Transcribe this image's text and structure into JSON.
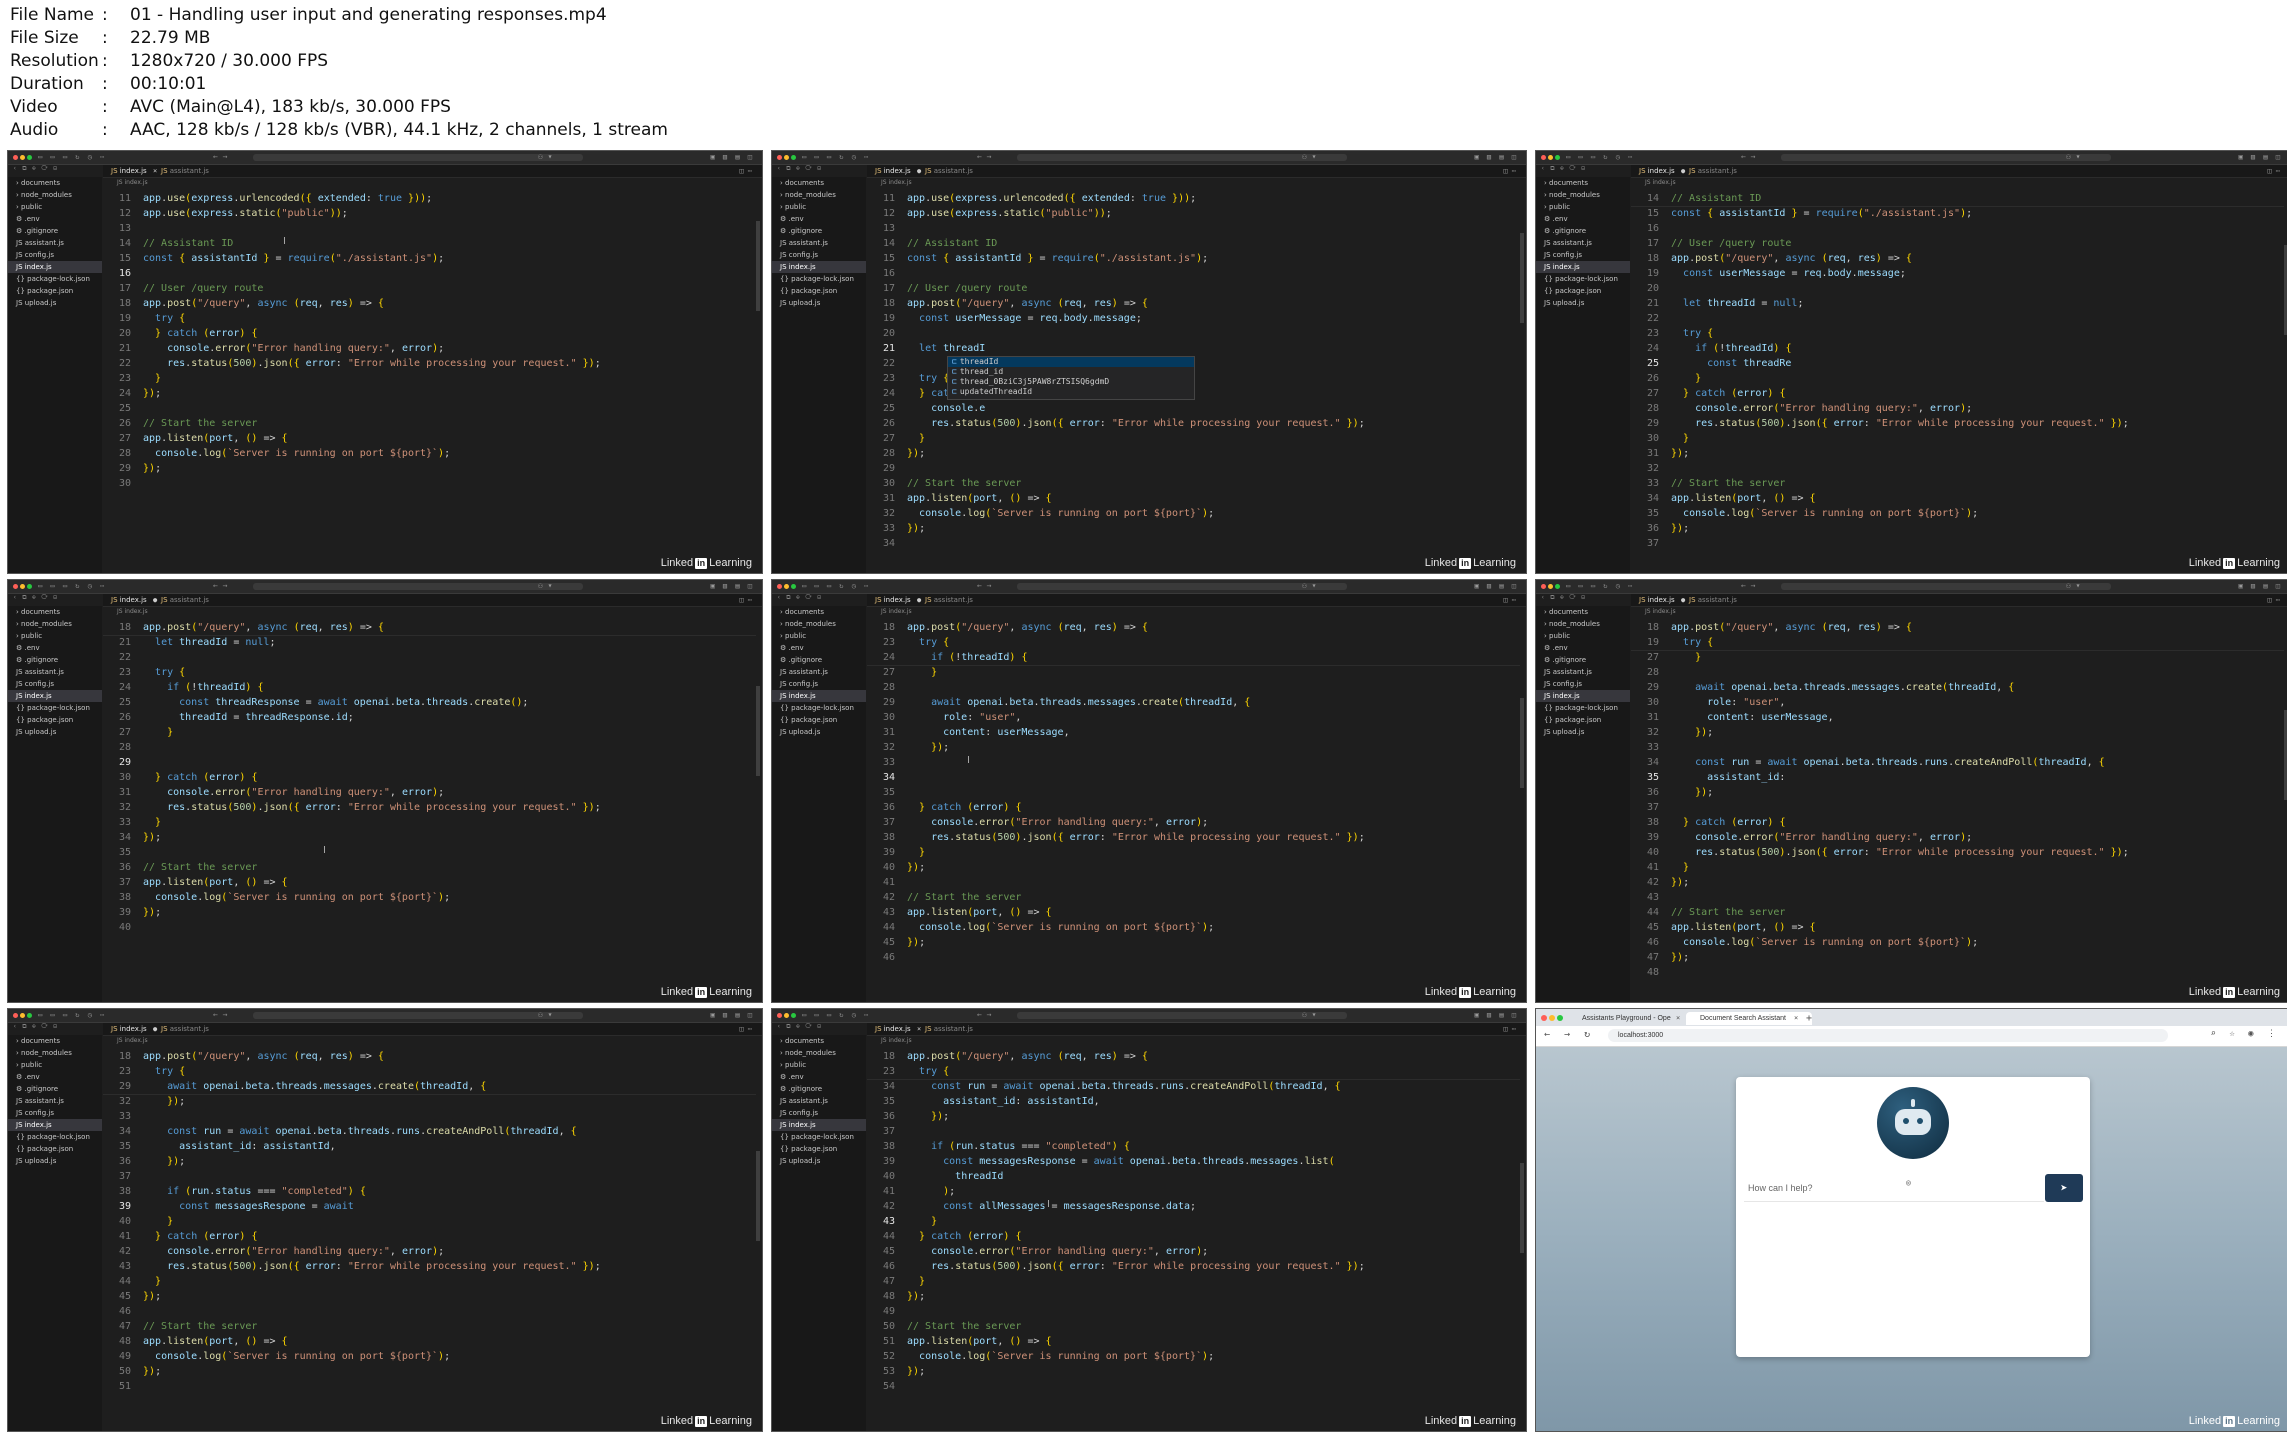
{
  "file_info": [
    {
      "key": "File Name",
      "value": "01 - Handling user input and generating responses.mp4"
    },
    {
      "key": "File Size",
      "value": "22.79 MB"
    },
    {
      "key": "Resolution",
      "value": "1280x720 / 30.000 FPS"
    },
    {
      "key": "Duration",
      "value": "00:10:01"
    },
    {
      "key": "Video",
      "value": "AVC (Main@L4), 183 kb/s, 30.000 FPS"
    },
    {
      "key": "Audio",
      "value": "AAC, 128 kb/s / 128 kb/s (VBR), 44.1 kHz, 2 channels, 1 stream"
    }
  ],
  "meta_separator": ":",
  "ide": {
    "tabs": [
      {
        "label": "index.js",
        "mark": "JS"
      },
      {
        "label": "assistant.js",
        "mark": "JS"
      }
    ],
    "breadcrumb": "index.js",
    "sidebar": [
      "documents",
      "node_modules",
      "public",
      ".env",
      ".gitignore",
      "assistant.js",
      "config.js",
      "index.js",
      "package-lock.json",
      "package.json",
      "upload.js"
    ]
  },
  "brand": {
    "name": "Linked",
    "in": "in",
    "suffix": "Learning"
  },
  "frames": [
    {
      "modified": false,
      "active_line": 16,
      "caret": {
        "line": 3
      },
      "lines": [
        {
          "n": 11,
          "code": "app.use(express.urlencoded({ extended: true }));"
        },
        {
          "n": 12,
          "code": "app.use(express.static(\"public\"));"
        },
        {
          "n": 13,
          "code": ""
        },
        {
          "n": 14,
          "code": "// Assistant ID"
        },
        {
          "n": 15,
          "code": "const { assistantId } = require(\"./assistant.js\");"
        },
        {
          "n": 16,
          "code": ""
        },
        {
          "n": 17,
          "code": "// User /query route"
        },
        {
          "n": 18,
          "code": "app.post(\"/query\", async (req, res) => {"
        },
        {
          "n": 19,
          "code": "  try {"
        },
        {
          "n": 20,
          "code": "  } catch (error) {"
        },
        {
          "n": 21,
          "code": "    console.error(\"Error handling query:\", error);"
        },
        {
          "n": 22,
          "code": "    res.status(500).json({ error: \"Error while processing your request.\" });"
        },
        {
          "n": 23,
          "code": "  }"
        },
        {
          "n": 24,
          "code": "});"
        },
        {
          "n": 25,
          "code": ""
        },
        {
          "n": 26,
          "code": "// Start the server"
        },
        {
          "n": 27,
          "code": "app.listen(port, () => {"
        },
        {
          "n": 28,
          "code": "  console.log(`Server is running on port ${port}`);"
        },
        {
          "n": 29,
          "code": "});"
        },
        {
          "n": 30,
          "code": ""
        }
      ]
    },
    {
      "modified": true,
      "active_line": 21,
      "autocomplete": {
        "after_line": 10,
        "items": [
          "threadId",
          "thread_id",
          "thread_0BziC3j5PAW8rZTSISQ6gdmD",
          "updatedThreadId"
        ]
      },
      "lines": [
        {
          "n": 11,
          "code": "app.use(express.urlencoded({ extended: true }));"
        },
        {
          "n": 12,
          "code": "app.use(express.static(\"public\"));"
        },
        {
          "n": 13,
          "code": ""
        },
        {
          "n": 14,
          "code": "// Assistant ID"
        },
        {
          "n": 15,
          "code": "const { assistantId } = require(\"./assistant.js\");"
        },
        {
          "n": 16,
          "code": ""
        },
        {
          "n": 17,
          "code": "// User /query route"
        },
        {
          "n": 18,
          "code": "app.post(\"/query\", async (req, res) => {"
        },
        {
          "n": 19,
          "code": "  const userMessage = req.body.message;"
        },
        {
          "n": 20,
          "code": ""
        },
        {
          "n": 21,
          "code": "  let threadI"
        },
        {
          "n": 22,
          "code": ""
        },
        {
          "n": 23,
          "code": "  try {"
        },
        {
          "n": 24,
          "code": "  } catch (er"
        },
        {
          "n": 25,
          "code": "    console.e"
        },
        {
          "n": 26,
          "code": "    res.status(500).json({ error: \"Error while processing your request.\" });"
        },
        {
          "n": 27,
          "code": "  }"
        },
        {
          "n": 28,
          "code": "});"
        },
        {
          "n": 29,
          "code": ""
        },
        {
          "n": 30,
          "code": "// Start the server"
        },
        {
          "n": 31,
          "code": "app.listen(port, () => {"
        },
        {
          "n": 32,
          "code": "  console.log(`Server is running on port ${port}`);"
        },
        {
          "n": 33,
          "code": "});"
        },
        {
          "n": 34,
          "code": ""
        }
      ]
    },
    {
      "modified": true,
      "active_line": 25,
      "lines": [
        {
          "n": 14,
          "code": "// Assistant ID",
          "sticky": true
        },
        {
          "n": 15,
          "code": "const { assistantId } = require(\"./assistant.js\");"
        },
        {
          "n": 16,
          "code": ""
        },
        {
          "n": 17,
          "code": "// User /query route"
        },
        {
          "n": 18,
          "code": "app.post(\"/query\", async (req, res) => {"
        },
        {
          "n": 19,
          "code": "  const userMessage = req.body.message;"
        },
        {
          "n": 20,
          "code": ""
        },
        {
          "n": 21,
          "code": "  let threadId = null;"
        },
        {
          "n": 22,
          "code": ""
        },
        {
          "n": 23,
          "code": "  try {"
        },
        {
          "n": 24,
          "code": "    if (!threadId) {"
        },
        {
          "n": 25,
          "code": "      const threadRe"
        },
        {
          "n": 26,
          "code": "    }"
        },
        {
          "n": 27,
          "code": "  } catch (error) {"
        },
        {
          "n": 28,
          "code": "    console.error(\"Error handling query:\", error);"
        },
        {
          "n": 29,
          "code": "    res.status(500).json({ error: \"Error while processing your request.\" });"
        },
        {
          "n": 30,
          "code": "  }"
        },
        {
          "n": 31,
          "code": "});"
        },
        {
          "n": 32,
          "code": ""
        },
        {
          "n": 33,
          "code": "// Start the server"
        },
        {
          "n": 34,
          "code": "app.listen(port, () => {"
        },
        {
          "n": 35,
          "code": "  console.log(`Server is running on port ${port}`);"
        },
        {
          "n": 36,
          "code": "});"
        },
        {
          "n": 37,
          "code": ""
        }
      ]
    },
    {
      "modified": true,
      "active_line": 29,
      "caret": {
        "line": 15
      },
      "lines": [
        {
          "n": 18,
          "code": "app.post(\"/query\", async (req, res) => {",
          "sticky": true
        },
        {
          "n": 21,
          "code": "  let threadId = null;"
        },
        {
          "n": 22,
          "code": ""
        },
        {
          "n": 23,
          "code": "  try {"
        },
        {
          "n": 24,
          "code": "    if (!threadId) {"
        },
        {
          "n": 25,
          "code": "      const threadResponse = await openai.beta.threads.create();"
        },
        {
          "n": 26,
          "code": "      threadId = threadResponse.id;"
        },
        {
          "n": 27,
          "code": "    }"
        },
        {
          "n": 28,
          "code": ""
        },
        {
          "n": 29,
          "code": ""
        },
        {
          "n": 30,
          "code": "  } catch (error) {"
        },
        {
          "n": 31,
          "code": "    console.error(\"Error handling query:\", error);"
        },
        {
          "n": 32,
          "code": "    res.status(500).json({ error: \"Error while processing your request.\" });"
        },
        {
          "n": 33,
          "code": "  }"
        },
        {
          "n": 34,
          "code": "});"
        },
        {
          "n": 35,
          "code": ""
        },
        {
          "n": 36,
          "code": "// Start the server"
        },
        {
          "n": 37,
          "code": "app.listen(port, () => {"
        },
        {
          "n": 38,
          "code": "  console.log(`Server is running on port ${port}`);"
        },
        {
          "n": 39,
          "code": "});"
        },
        {
          "n": 40,
          "code": ""
        }
      ]
    },
    {
      "modified": true,
      "active_line": 34,
      "caret": {
        "line": 9
      },
      "lines": [
        {
          "n": 18,
          "code": "app.post(\"/query\", async (req, res) => {",
          "sticky": true
        },
        {
          "n": 23,
          "code": "  try {",
          "sticky": true
        },
        {
          "n": 24,
          "code": "    if (!threadId) {",
          "sticky": true
        },
        {
          "n": 27,
          "code": "    }"
        },
        {
          "n": 28,
          "code": ""
        },
        {
          "n": 29,
          "code": "    await openai.beta.threads.messages.create(threadId, {"
        },
        {
          "n": 30,
          "code": "      role: \"user\","
        },
        {
          "n": 31,
          "code": "      content: userMessage,"
        },
        {
          "n": 32,
          "code": "    });"
        },
        {
          "n": 33,
          "code": ""
        },
        {
          "n": 34,
          "code": ""
        },
        {
          "n": 35,
          "code": ""
        },
        {
          "n": 36,
          "code": "  } catch (error) {"
        },
        {
          "n": 37,
          "code": "    console.error(\"Error handling query:\", error);"
        },
        {
          "n": 38,
          "code": "    res.status(500).json({ error: \"Error while processing your request.\" });"
        },
        {
          "n": 39,
          "code": "  }"
        },
        {
          "n": 40,
          "code": "});"
        },
        {
          "n": 41,
          "code": ""
        },
        {
          "n": 42,
          "code": "// Start the server"
        },
        {
          "n": 43,
          "code": "app.listen(port, () => {"
        },
        {
          "n": 44,
          "code": "  console.log(`Server is running on port ${port}`);"
        },
        {
          "n": 45,
          "code": "});"
        },
        {
          "n": 46,
          "code": ""
        }
      ]
    },
    {
      "modified": true,
      "active_line": 35,
      "lines": [
        {
          "n": 18,
          "code": "app.post(\"/query\", async (req, res) => {",
          "sticky": true
        },
        {
          "n": 19,
          "code": "  try {",
          "sticky": true
        },
        {
          "n": 27,
          "code": "    }"
        },
        {
          "n": 28,
          "code": ""
        },
        {
          "n": 29,
          "code": "    await openai.beta.threads.messages.create(threadId, {"
        },
        {
          "n": 30,
          "code": "      role: \"user\","
        },
        {
          "n": 31,
          "code": "      content: userMessage,"
        },
        {
          "n": 32,
          "code": "    });"
        },
        {
          "n": 33,
          "code": ""
        },
        {
          "n": 34,
          "code": "    const run = await openai.beta.threads.runs.createAndPoll(threadId, {"
        },
        {
          "n": 35,
          "code": "      assistant_id: "
        },
        {
          "n": 36,
          "code": "    });"
        },
        {
          "n": 37,
          "code": ""
        },
        {
          "n": 38,
          "code": "  } catch (error) {"
        },
        {
          "n": 39,
          "code": "    console.error(\"Error handling query:\", error);"
        },
        {
          "n": 40,
          "code": "    res.status(500).json({ error: \"Error while processing your request.\" });"
        },
        {
          "n": 41,
          "code": "  }"
        },
        {
          "n": 42,
          "code": "});"
        },
        {
          "n": 43,
          "code": ""
        },
        {
          "n": 44,
          "code": "// Start the server"
        },
        {
          "n": 45,
          "code": "app.listen(port, () => {"
        },
        {
          "n": 46,
          "code": "  console.log(`Server is running on port ${port}`);"
        },
        {
          "n": 47,
          "code": "});"
        },
        {
          "n": 48,
          "code": ""
        }
      ]
    },
    {
      "modified": true,
      "active_line": 39,
      "lines": [
        {
          "n": 18,
          "code": "app.post(\"/query\", async (req, res) => {",
          "sticky": true
        },
        {
          "n": 23,
          "code": "  try {",
          "sticky": true
        },
        {
          "n": 29,
          "code": "    await openai.beta.threads.messages.create(threadId, {",
          "sticky": true
        },
        {
          "n": 32,
          "code": "    });"
        },
        {
          "n": 33,
          "code": ""
        },
        {
          "n": 34,
          "code": "    const run = await openai.beta.threads.runs.createAndPoll(threadId, {"
        },
        {
          "n": 35,
          "code": "      assistant_id: assistantId,"
        },
        {
          "n": 36,
          "code": "    });"
        },
        {
          "n": 37,
          "code": ""
        },
        {
          "n": 38,
          "code": "    if (run.status === \"completed\") {"
        },
        {
          "n": 39,
          "code": "      const messagesRespone = await"
        },
        {
          "n": 40,
          "code": "    }"
        },
        {
          "n": 41,
          "code": "  } catch (error) {"
        },
        {
          "n": 42,
          "code": "    console.error(\"Error handling query:\", error);"
        },
        {
          "n": 43,
          "code": "    res.status(500).json({ error: \"Error while processing your request.\" });"
        },
        {
          "n": 44,
          "code": "  }"
        },
        {
          "n": 45,
          "code": "});"
        },
        {
          "n": 46,
          "code": ""
        },
        {
          "n": 47,
          "code": "// Start the server"
        },
        {
          "n": 48,
          "code": "app.listen(port, () => {"
        },
        {
          "n": 49,
          "code": "  console.log(`Server is running on port ${port}`);"
        },
        {
          "n": 50,
          "code": "});"
        },
        {
          "n": 51,
          "code": ""
        }
      ]
    },
    {
      "modified": false,
      "active_line": 43,
      "caret": {
        "line": 10
      },
      "lines": [
        {
          "n": 18,
          "code": "app.post(\"/query\", async (req, res) => {",
          "sticky": true
        },
        {
          "n": 23,
          "code": "  try {",
          "sticky": true
        },
        {
          "n": 34,
          "code": "    const run = await openai.beta.threads.runs.createAndPoll(threadId, {"
        },
        {
          "n": 35,
          "code": "      assistant_id: assistantId,"
        },
        {
          "n": 36,
          "code": "    });"
        },
        {
          "n": 37,
          "code": ""
        },
        {
          "n": 38,
          "code": "    if (run.status === \"completed\") {"
        },
        {
          "n": 39,
          "code": "      const messagesResponse = await openai.beta.threads.messages.list("
        },
        {
          "n": 40,
          "code": "        threadId"
        },
        {
          "n": 41,
          "code": "      );"
        },
        {
          "n": 42,
          "code": "      const allMessages = messagesResponse.data;"
        },
        {
          "n": 43,
          "code": "    }"
        },
        {
          "n": 44,
          "code": "  } catch (error) {"
        },
        {
          "n": 45,
          "code": "    console.error(\"Error handling query:\", error);"
        },
        {
          "n": 46,
          "code": "    res.status(500).json({ error: \"Error while processing your request.\" });"
        },
        {
          "n": 47,
          "code": "  }"
        },
        {
          "n": 48,
          "code": "});"
        },
        {
          "n": 49,
          "code": ""
        },
        {
          "n": 50,
          "code": "// Start the server"
        },
        {
          "n": 51,
          "code": "app.listen(port, () => {"
        },
        {
          "n": 52,
          "code": "  console.log(`Server is running on port ${port}`);"
        },
        {
          "n": 53,
          "code": "});"
        },
        {
          "n": 54,
          "code": ""
        }
      ]
    }
  ],
  "browser": {
    "tabs": [
      "Assistants Playground - Ope",
      "Document Search Assistant"
    ],
    "url": "localhost:3000",
    "chat_placeholder": "How can I help?",
    "send_label": "➤"
  }
}
